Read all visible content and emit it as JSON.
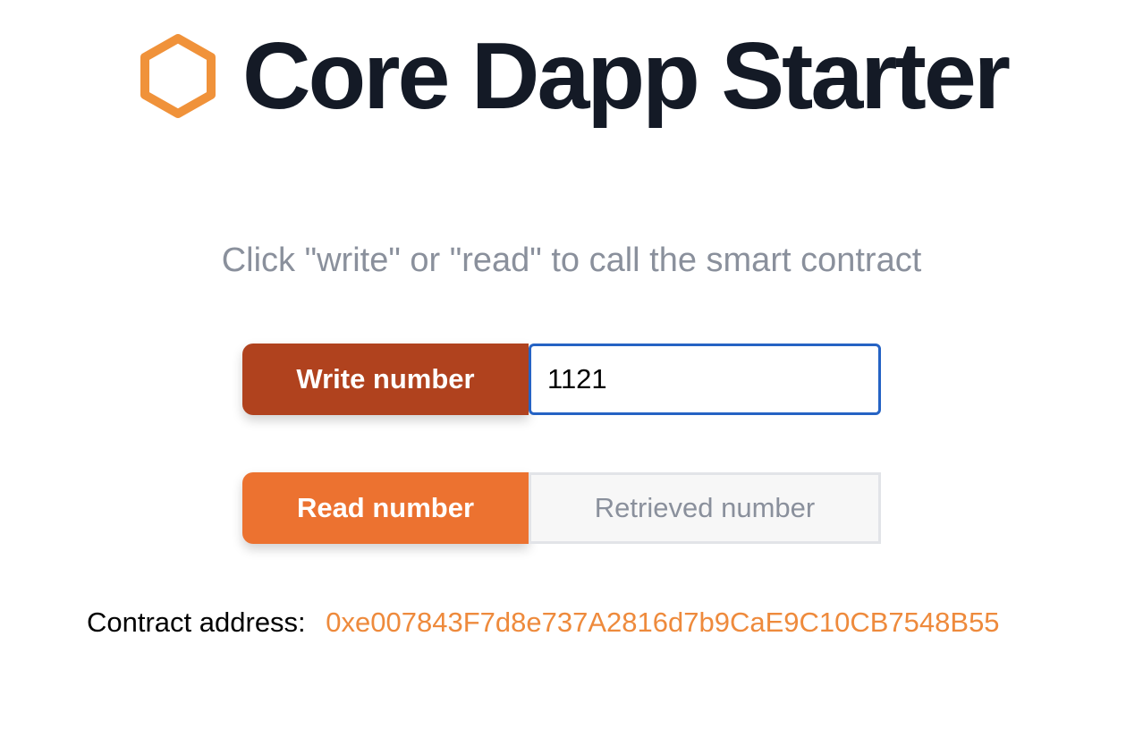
{
  "header": {
    "logo_icon": "hexagon-icon",
    "title": "Core Dapp Starter"
  },
  "instructions": "Click \"write\" or \"read\" to call the smart contract",
  "write": {
    "button_label": "Write number",
    "input_value": "1121"
  },
  "read": {
    "button_label": "Read number",
    "result_placeholder": "Retrieved number"
  },
  "contract": {
    "label": "Contract address:",
    "address": "0xe007843F7d8e737A2816d7b9CaE9C10CB7548B55"
  },
  "colors": {
    "accent": "#ec7230",
    "accent_dark": "#b0421e",
    "logo": "#f0923a",
    "title": "#141a26",
    "muted": "#8a909c",
    "focus": "#2563c4",
    "link": "#ee8a3c"
  }
}
